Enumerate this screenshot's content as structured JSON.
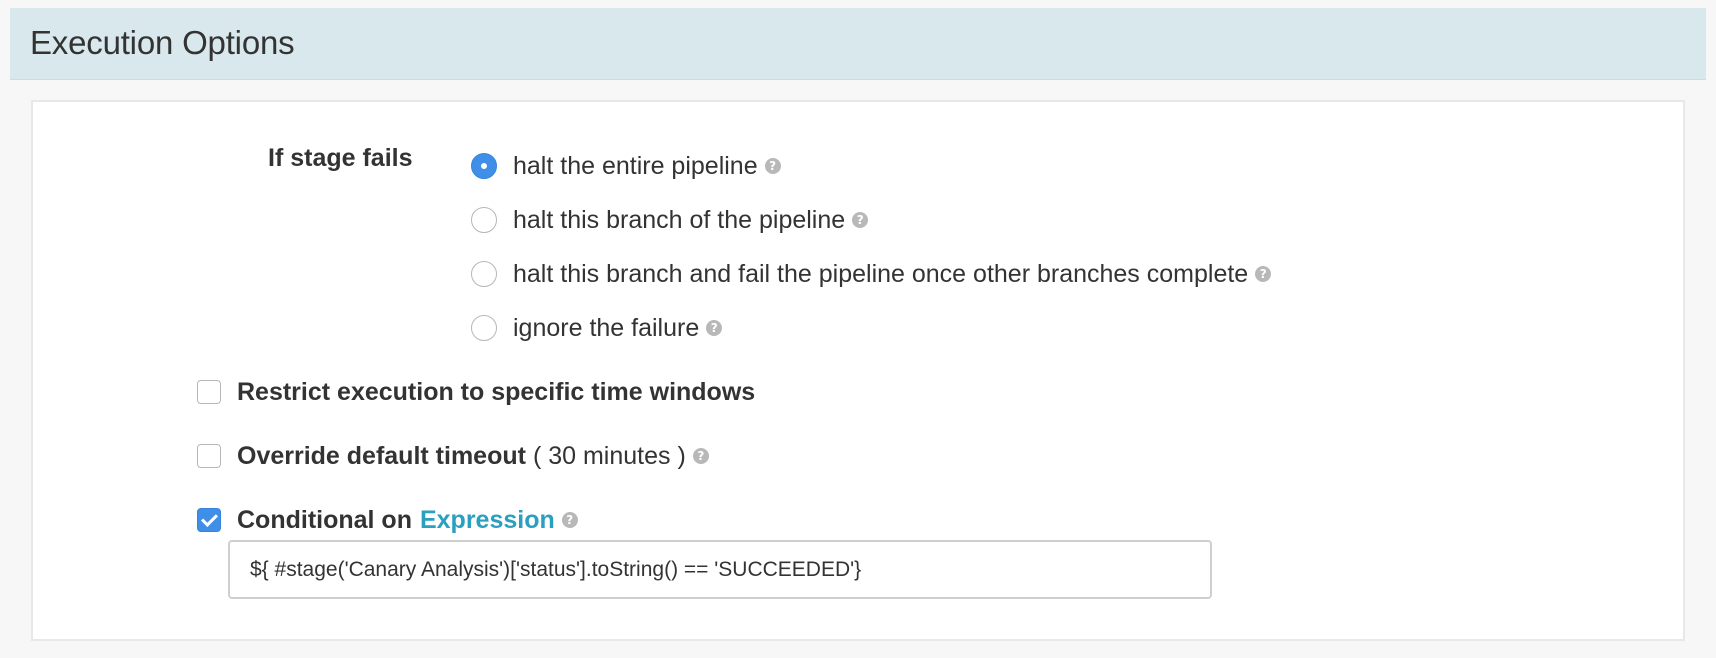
{
  "section": {
    "title": "Execution Options"
  },
  "fail_options": {
    "label": "If stage fails",
    "options": [
      {
        "label": "halt the entire pipeline",
        "selected": true
      },
      {
        "label": "halt this branch of the pipeline",
        "selected": false
      },
      {
        "label": "halt this branch and fail the pipeline once other branches complete",
        "selected": false
      },
      {
        "label": "ignore the failure",
        "selected": false
      }
    ]
  },
  "restrict": {
    "label": "Restrict execution to specific time windows",
    "checked": false
  },
  "timeout": {
    "label": "Override default timeout",
    "extra": "( 30 minutes )",
    "checked": false
  },
  "conditional": {
    "label": "Conditional on",
    "link": "Expression",
    "checked": true,
    "expression_value": "${ #stage('Canary Analysis')['status'].toString() == 'SUCCEEDED'}"
  },
  "help_icon": "question-icon",
  "colors": {
    "accent": "#3f8fe8",
    "link": "#2a9fbf",
    "header_bg": "#d8e8ed"
  }
}
